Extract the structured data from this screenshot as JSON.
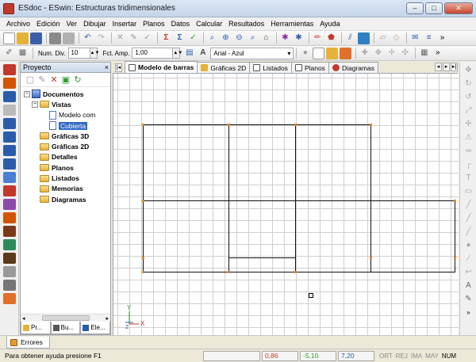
{
  "window": {
    "title": "ESdoc - ESwin: Estructuras tridimensionales",
    "min": "–",
    "max": "□",
    "close": "✕"
  },
  "menu": [
    "Archivo",
    "Edición",
    "Ver",
    "Dibujar",
    "Insertar",
    "Planos",
    "Datos",
    "Calcular",
    "Resultados",
    "Herramientas",
    "Ayuda"
  ],
  "toolbar2": {
    "num_div_label": "Num. Div.",
    "num_div_value": "10",
    "fct_amp_label": "Fct. Amp.",
    "fct_amp_value": "1,00",
    "font_select": "Arial - Azul"
  },
  "panel": {
    "title": "Proyecto",
    "close": "×",
    "tree": {
      "root": "Documentos",
      "vistas": "Vistas",
      "vista_items": [
        "Modelo com",
        "Cubierta"
      ],
      "folders": [
        "Gráficas 3D",
        "Gráficas 2D",
        "Detalles",
        "Planos",
        "Listados",
        "Memorias",
        "Diagramas"
      ]
    },
    "tabs": [
      "Pr...",
      "Bu...",
      "Ele..."
    ]
  },
  "tabs": [
    {
      "label": "Modelo de barras",
      "active": true
    },
    {
      "label": "Gráficas 2D",
      "active": false
    },
    {
      "label": "Listados",
      "active": false
    },
    {
      "label": "Planos",
      "active": false
    },
    {
      "label": "Diagramas",
      "active": false
    }
  ],
  "axis": {
    "y": "Y",
    "x": "X",
    "z": "Z"
  },
  "errors_tab": "Errores",
  "status": {
    "help": "Para obtener ayuda presione F1",
    "x": "0,86",
    "y": "-5,10",
    "z": "7,20",
    "indicators": [
      "ORT",
      "REJ",
      "IMA",
      "MAY",
      "NUM"
    ],
    "active_indicator": "NUM"
  }
}
